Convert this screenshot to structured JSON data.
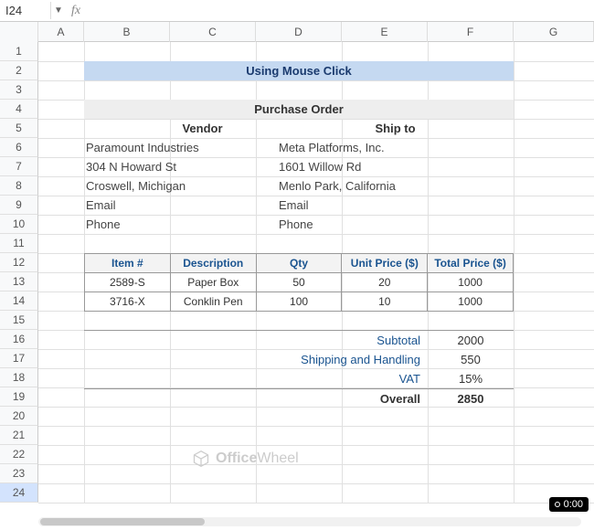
{
  "formula_bar": {
    "cell_ref": "I24",
    "fx": "fx",
    "value": ""
  },
  "columns": [
    "",
    "A",
    "B",
    "C",
    "D",
    "E",
    "F",
    "G"
  ],
  "rows": [
    "1",
    "2",
    "3",
    "4",
    "5",
    "6",
    "7",
    "8",
    "9",
    "10",
    "11",
    "12",
    "13",
    "14",
    "15",
    "16",
    "17",
    "18",
    "19",
    "20",
    "21",
    "22",
    "23",
    "24"
  ],
  "active_row": "24",
  "title": "Using Mouse Click",
  "header": "Purchase Order",
  "vendor": {
    "label": "Vendor",
    "name": "Paramount Industries",
    "street": "304 N Howard St",
    "city": "Croswell, Michigan",
    "email": "Email",
    "phone": "Phone"
  },
  "shipto": {
    "label": "Ship to",
    "name": "Meta Platforms, Inc.",
    "street": "1601 Willow Rd",
    "city": "Menlo Park, California",
    "email": "Email",
    "phone": "Phone"
  },
  "items": {
    "headers": {
      "item": "Item #",
      "desc": "Description",
      "qty": "Qty",
      "unit": "Unit Price ($)",
      "total": "Total Price ($)"
    },
    "rows": [
      {
        "item": "2589-S",
        "desc": "Paper Box",
        "qty": "50",
        "unit": "20",
        "total": "1000"
      },
      {
        "item": "3716-X",
        "desc": "Conklin Pen",
        "qty": "100",
        "unit": "10",
        "total": "1000"
      }
    ]
  },
  "summary": {
    "subtotal": {
      "label": "Subtotal",
      "value": "2000"
    },
    "shipping": {
      "label": "Shipping and Handling",
      "value": "550"
    },
    "vat": {
      "label": "VAT",
      "value": "15%"
    },
    "overall": {
      "label": "Overall",
      "value": "2850"
    }
  },
  "watermark": {
    "prefix": "Office",
    "suffix": "Wheel"
  },
  "timer": "0:00"
}
